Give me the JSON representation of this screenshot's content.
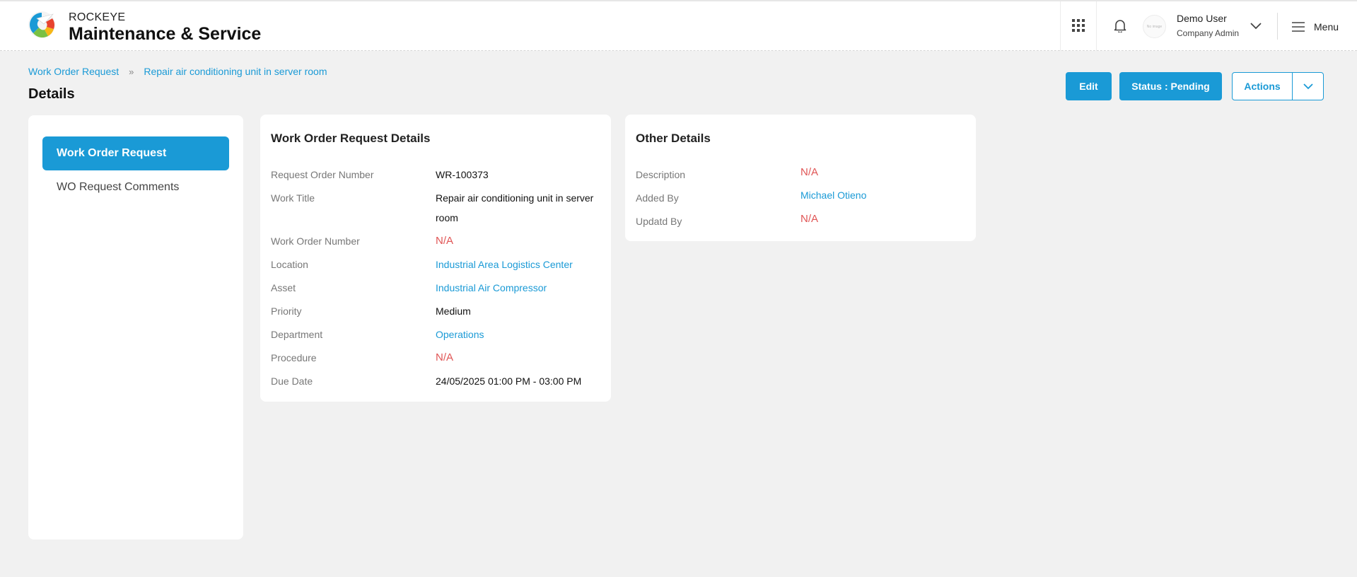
{
  "header": {
    "brand_top": "ROCKEYE",
    "brand_main": "Maintenance & Service",
    "avatar_text": "No image",
    "user_name": "Demo User",
    "user_role": "Company Admin",
    "menu_label": "Menu",
    "icons": [
      "apps-grid-icon",
      "bell-icon",
      "chevron-down-icon",
      "hamburger-menu-icon"
    ]
  },
  "breadcrumb": {
    "root": "Work Order Request",
    "current": "Repair air conditioning unit in server room"
  },
  "page_title": "Details",
  "toolbar": {
    "edit_label": "Edit",
    "status_label": "Status : Pending",
    "actions_label": "Actions"
  },
  "sidebar": {
    "items": [
      {
        "label": "Work Order Request",
        "active": true
      },
      {
        "label": "WO Request Comments",
        "active": false
      }
    ]
  },
  "details": {
    "title": "Work Order Request Details",
    "rows": [
      {
        "label": "Request Order Number",
        "value": "WR-100373"
      },
      {
        "label": "Work Title",
        "value": "Repair air conditioning unit in server room"
      },
      {
        "label": "Work Order Number",
        "value": "N/A"
      },
      {
        "label": "Location",
        "value": "Industrial Area Logistics Center"
      },
      {
        "label": "Asset",
        "value": "Industrial Air Compressor"
      },
      {
        "label": "Priority",
        "value": "Medium"
      },
      {
        "label": "Department",
        "value": "Operations"
      },
      {
        "label": "Procedure",
        "value": "N/A"
      },
      {
        "label": "Due Date",
        "value": "24/05/2025 01:00 PM - 03:00 PM"
      }
    ]
  },
  "other": {
    "title": "Other Details",
    "rows": [
      {
        "label": "Description",
        "value": "N/A"
      },
      {
        "label": "Added By",
        "value": "Michael Otieno"
      },
      {
        "label": "Updatd By",
        "value": "N/A"
      }
    ]
  },
  "colors": {
    "accent": "#1a9ad6",
    "na": "#e05555",
    "background": "#f1f1f1"
  }
}
